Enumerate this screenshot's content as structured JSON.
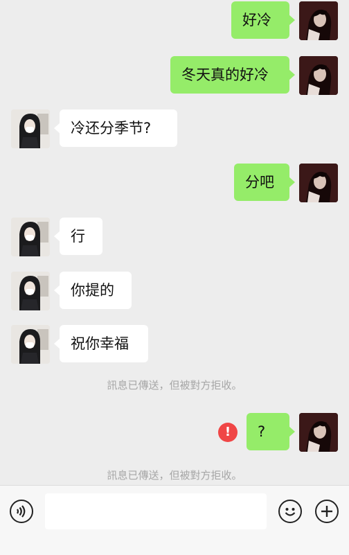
{
  "messages": [
    {
      "side": "me",
      "text": "好冷"
    },
    {
      "side": "me",
      "text": "冬天真的好冷"
    },
    {
      "side": "them",
      "text": "冷还分季节?"
    },
    {
      "side": "me",
      "text": "分吧"
    },
    {
      "side": "them",
      "text": "行"
    },
    {
      "side": "them",
      "text": "你提的"
    },
    {
      "side": "them",
      "text": "祝你幸福"
    },
    {
      "side": "me",
      "text": "?",
      "status": "failed"
    }
  ],
  "system": {
    "rejected_notice_1": "訊息已傳送，但被對方拒收。",
    "rejected_notice_2": "訊息已傳送，但被對方拒收。",
    "error_glyph": "!"
  },
  "input_bar": {
    "voice_icon": "voice-icon",
    "emoji_icon": "emoji-icon",
    "plus_icon": "plus-icon",
    "message_value": ""
  },
  "colors": {
    "background": "#ededed",
    "my_bubble": "#95ec69",
    "their_bubble": "#ffffff",
    "error": "#f04646",
    "system_text": "#a6a6a6"
  }
}
